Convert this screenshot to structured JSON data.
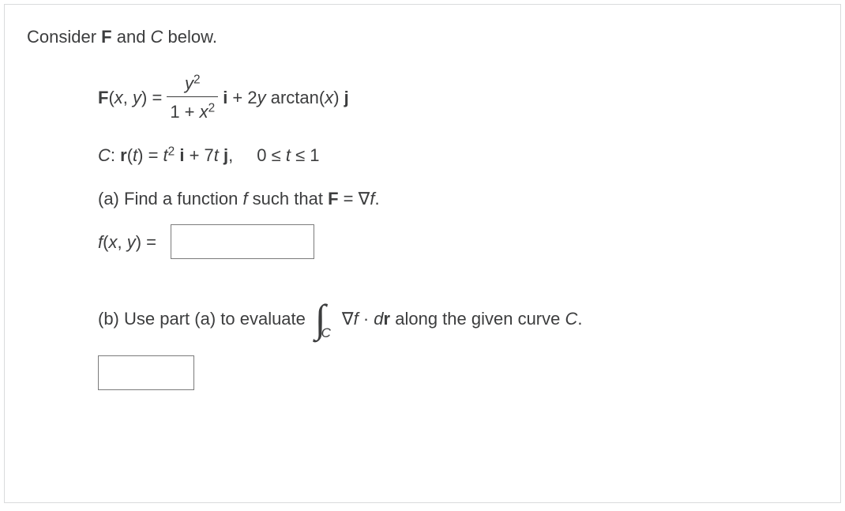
{
  "intro": {
    "prefix": "Consider ",
    "Fb": "F",
    "mid": " and ",
    "Ci": "C",
    "suffix": " below."
  },
  "eqF": {
    "Flabel": "F",
    "args": "(",
    "x": "x",
    "comma": ", ",
    "y": "y",
    "close": ") = ",
    "num_y": "y",
    "num_exp": "2",
    "den_pre": "1 + ",
    "den_x": "x",
    "den_exp": "2",
    "mid1": " ",
    "ib": "i",
    "mid2": " + 2",
    "y2": "y",
    "mid3": " arctan(",
    "x3": "x",
    "mid4": ") ",
    "jb": "j"
  },
  "eqC": {
    "Ci": "C",
    "colon": ": ",
    "rb": "r",
    "args": "(",
    "t": "t",
    "close": ") = ",
    "t2": "t",
    "exp2": "2",
    "sp": " ",
    "ib": "i",
    "plus": " + 7",
    "t3": "t",
    "sp2": " ",
    "jb": "j",
    "comma": ",",
    "range": "0 ≤ ",
    "t4": "t",
    "range2": " ≤ 1"
  },
  "partA": {
    "a": "(a) Find a function ",
    "f": "f",
    "mid": " such that ",
    "Fb": "F",
    "eq": " = ∇",
    "f2": "f",
    "dot": ".",
    "flabel": "f",
    "args": "(",
    "x": "x",
    "comma": ", ",
    "y": "y",
    "close": ") ="
  },
  "partB": {
    "b": "(b) Use part (a) to evaluate ",
    "intSub": "C",
    "grad": "∇",
    "f": "f",
    "dot": " · ",
    "drPre": "d",
    "r": "r",
    "tail": "  along the given curve ",
    "Ci": "C",
    "period": "."
  }
}
